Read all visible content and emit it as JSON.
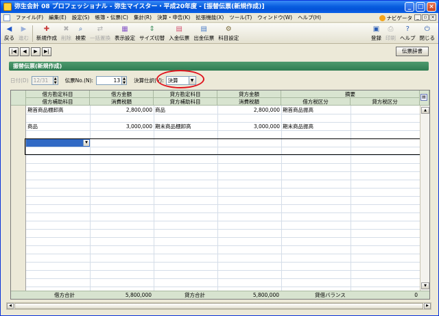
{
  "window": {
    "title": "弥生会計 08 プロフェッショナル - 弥生マイスター・平成20年度 - [振替伝票(新規作成)]",
    "minimize": "_",
    "maximize": "□",
    "close": "×"
  },
  "menu": {
    "items": [
      "ファイル(F)",
      "編集(E)",
      "設定(S)",
      "帳簿・伝票(C)",
      "集計(R)",
      "決算・申告(K)",
      "拡張機能(X)",
      "ツール(T)",
      "ウィンドウ(W)",
      "ヘルプ(H)"
    ],
    "navi_label": "ナビゲータ",
    "mdi_min": "_",
    "mdi_restore": "▫",
    "mdi_close": "×"
  },
  "toolbar": {
    "back": "戻る",
    "forward": "進む",
    "new": "新規作成",
    "delete": "削除",
    "search": "検索",
    "bulk_replace": "一括置換",
    "display_settings": "表示設定",
    "size_switch": "サイズ切替",
    "deposit_slip": "入金伝票",
    "withdrawal_slip": "出金伝票",
    "account_settings": "科目設定",
    "register": "登録",
    "print": "印刷",
    "help": "ヘルプ",
    "close": "閉じる"
  },
  "nav": {
    "first": "|◀",
    "prev": "◀",
    "next": "▶",
    "last": "▶|",
    "dictionary": "伝票辞書"
  },
  "form": {
    "header": "振替伝票(新規作成)",
    "date_label": "日付(D)",
    "date_value": "12/31",
    "slip_no_label": "伝票No.(N):",
    "slip_no_value": "13",
    "settlement_label": "決算仕訳(V):",
    "settlement_value": "決算"
  },
  "grid": {
    "headers_top": [
      "借方勘定科目",
      "借方金額",
      "貸方勘定科目",
      "貸方金額",
      "摘要"
    ],
    "headers_bottom": [
      "借方補助科目",
      "消費税額",
      "貸方補助科目",
      "消費税額",
      "借方税区分",
      "貸方税区分"
    ],
    "rows": [
      {
        "debit_account": "期首商品棚卸高",
        "debit_amount": "2,800,000",
        "credit_account": "商品",
        "credit_amount": "2,800,000",
        "memo": "期首商品振高"
      },
      {
        "debit_account": "商品",
        "debit_amount": "3,000,000",
        "credit_account": "期末商品棚卸高",
        "credit_amount": "3,000,000",
        "memo": "期末商品振高"
      }
    ],
    "footer": {
      "debit_total_label": "借方合計",
      "debit_total": "5,800,000",
      "credit_total_label": "貸方合計",
      "credit_total": "5,800,000",
      "balance_label": "貸借バランス",
      "balance": "0"
    }
  },
  "colors": {
    "title_blue": "#0A5FE0",
    "header_green": "#2F7D52",
    "grid_header": "#D7E3CF",
    "highlight_red": "#E0141E",
    "selection": "#316AC5"
  }
}
